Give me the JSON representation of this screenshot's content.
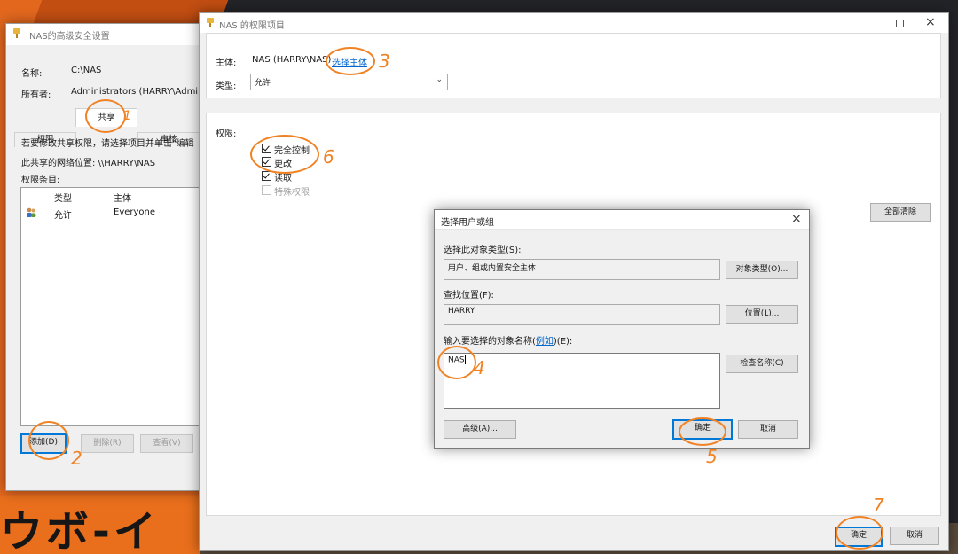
{
  "adv_window": {
    "title": "NAS的高级安全设置",
    "name_label": "名称:",
    "name_value": "C:\\NAS",
    "owner_label": "所有者:",
    "owner_value": "Administrators (HARRY\\Adminis",
    "tabs": [
      "权限",
      "共享",
      "审核"
    ],
    "instruction": "若要修改共享权限，请选择项目并单击\"编辑",
    "network_location": "此共享的网络位置:  \\\\HARRY\\NAS",
    "entries_label": "权限条目:",
    "columns": [
      "类型",
      "主体"
    ],
    "rows": [
      {
        "type": "允许",
        "principal": "Everyone"
      }
    ],
    "add_button": "添加(D)",
    "remove_button": "删除(R)",
    "view_button": "查看(V)"
  },
  "perm_window": {
    "title": "NAS 的权限项目",
    "principal_label": "主体:",
    "principal_value": "NAS (HARRY\\NAS)",
    "select_principal_link": "选择主体",
    "type_label": "类型:",
    "type_value": "允许",
    "permissions_label": "权限:",
    "permissions": [
      {
        "label": "完全控制",
        "checked": true,
        "disabled": false
      },
      {
        "label": "更改",
        "checked": true,
        "disabled": false
      },
      {
        "label": "读取",
        "checked": true,
        "disabled": false
      },
      {
        "label": "特殊权限",
        "checked": false,
        "disabled": true
      }
    ],
    "clear_all_button": "全部清除",
    "ok_button": "确定",
    "cancel_button": "取消"
  },
  "select_dialog": {
    "title": "选择用户或组",
    "object_type_label": "选择此对象类型(S):",
    "object_type_value": "用户、组或内置安全主体",
    "object_types_button": "对象类型(O)...",
    "location_label": "查找位置(F):",
    "location_value": "HARRY",
    "location_button": "位置(L)...",
    "names_label_prefix": "输入要选择的对象名称(",
    "names_label_link": "例如",
    "names_label_suffix": ")(E):",
    "names_value": "NAS",
    "check_names_button": "检查名称(C)",
    "advanced_button": "高级(A)...",
    "ok_button": "确定",
    "cancel_button": "取消"
  },
  "annotations": [
    "1",
    "2",
    "3",
    "4",
    "5",
    "6",
    "7"
  ],
  "desktop_text": "ウボ-イ",
  "colors": {
    "accent_blue": "#0078d7",
    "annotation_orange": "#f08224",
    "desktop_orange": "#e3681e"
  }
}
